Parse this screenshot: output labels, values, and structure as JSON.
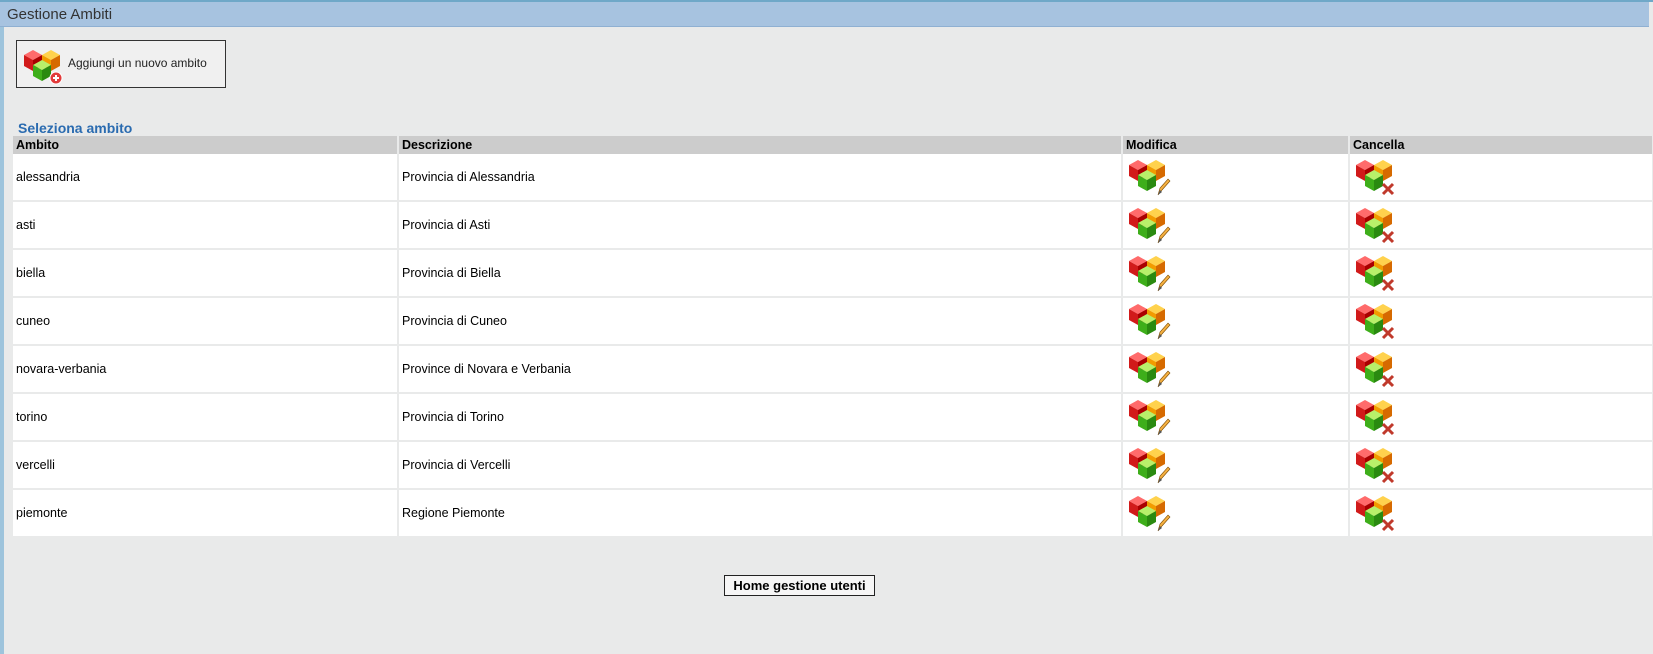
{
  "header": {
    "title": "Gestione Ambiti"
  },
  "toolbar": {
    "add_label": "Aggiungi un nuovo ambito",
    "add_icon": "cubes-add-icon"
  },
  "section": {
    "title": "Seleziona ambito"
  },
  "table": {
    "headers": [
      "Ambito",
      "Descrizione",
      "Modifica",
      "Cancella"
    ],
    "rows": [
      {
        "ambito": "alessandria",
        "descrizione": "Provincia di Alessandria"
      },
      {
        "ambito": "asti",
        "descrizione": "Provincia di Asti"
      },
      {
        "ambito": "biella",
        "descrizione": "Provincia di Biella"
      },
      {
        "ambito": "cuneo",
        "descrizione": "Provincia di Cuneo"
      },
      {
        "ambito": "novara-verbania",
        "descrizione": "Province di Novara e Verbania"
      },
      {
        "ambito": "torino",
        "descrizione": "Provincia di Torino"
      },
      {
        "ambito": "vercelli",
        "descrizione": "Provincia di Vercelli"
      },
      {
        "ambito": "piemonte",
        "descrizione": "Regione Piemonte"
      }
    ],
    "edit_icon": "cubes-edit-icon",
    "delete_icon": "cubes-delete-icon"
  },
  "footer": {
    "home_label": "Home gestione utenti"
  },
  "colors": {
    "title_bar": "#a7c3e0",
    "section_title": "#2a6bb0",
    "panel": "#e9eaea",
    "header_row": "#cccccc"
  }
}
